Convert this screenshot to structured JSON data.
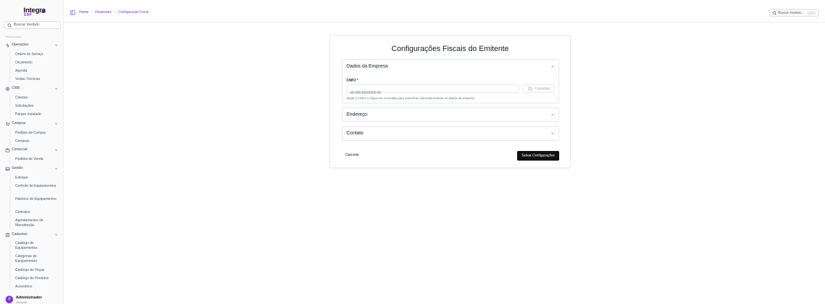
{
  "app": {
    "logo_main": "Integra",
    "logo_sub": "ERP"
  },
  "sidebar": {
    "search_label": "Buscar modulo",
    "section_label": "PRINCIPAL",
    "groups": [
      {
        "label": "Operações",
        "icon": "activity-icon",
        "items": [
          "Ordem de Serviço",
          "Orçamento",
          "Agenda",
          "Visitas Técnicas"
        ]
      },
      {
        "label": "CRM",
        "icon": "target-icon",
        "items": [
          "Clientes",
          "Solicitações",
          "Parque Instalado"
        ]
      },
      {
        "label": "Compras",
        "icon": "cart-icon",
        "items": [
          "Pedidos de Compra",
          "Compras"
        ]
      },
      {
        "label": "Comercial",
        "icon": "briefcase-icon",
        "items": [
          "Pedidos de Venda"
        ]
      },
      {
        "label": "Gestão",
        "icon": "inbox-icon",
        "items": [
          "Estoque",
          "Controle de Equipamentos",
          "Histórico de Equipamentos",
          "Contratos",
          "Agendamentos de Manutenção"
        ]
      },
      {
        "label": "Cadastros",
        "icon": "database-icon",
        "items": [
          "Catálogo de Equipamentos",
          "Categorias de Equipamentos",
          "Catálogo de Peças",
          "Catálogo de Produtos",
          "Acessórios"
        ]
      }
    ],
    "user": {
      "initial": "A",
      "name": "Administrador",
      "subtitle": "Ver perfil"
    }
  },
  "header": {
    "breadcrumb": [
      "Home",
      "Financeiro",
      "Configuração Fiscal"
    ],
    "search_label": "Buscar modulo...",
    "search_shortcut": "Ctrl+K"
  },
  "main": {
    "title": "Configurações Fiscais do Emitente",
    "sections": {
      "empresa": {
        "title": "Dados da Empresa",
        "cnpj_label": "CNPJ *",
        "cnpj_placeholder": "00.000.000/0000-00",
        "consult_label": "Consultar",
        "hint": "Digite o CNPJ e clique em Consultar para preencher automaticamente os dados da empresa"
      },
      "endereco": {
        "title": "Endereço"
      },
      "contato": {
        "title": "Contato"
      }
    },
    "cancel_label": "Cancelar",
    "save_label": "Salvar Configurações"
  }
}
